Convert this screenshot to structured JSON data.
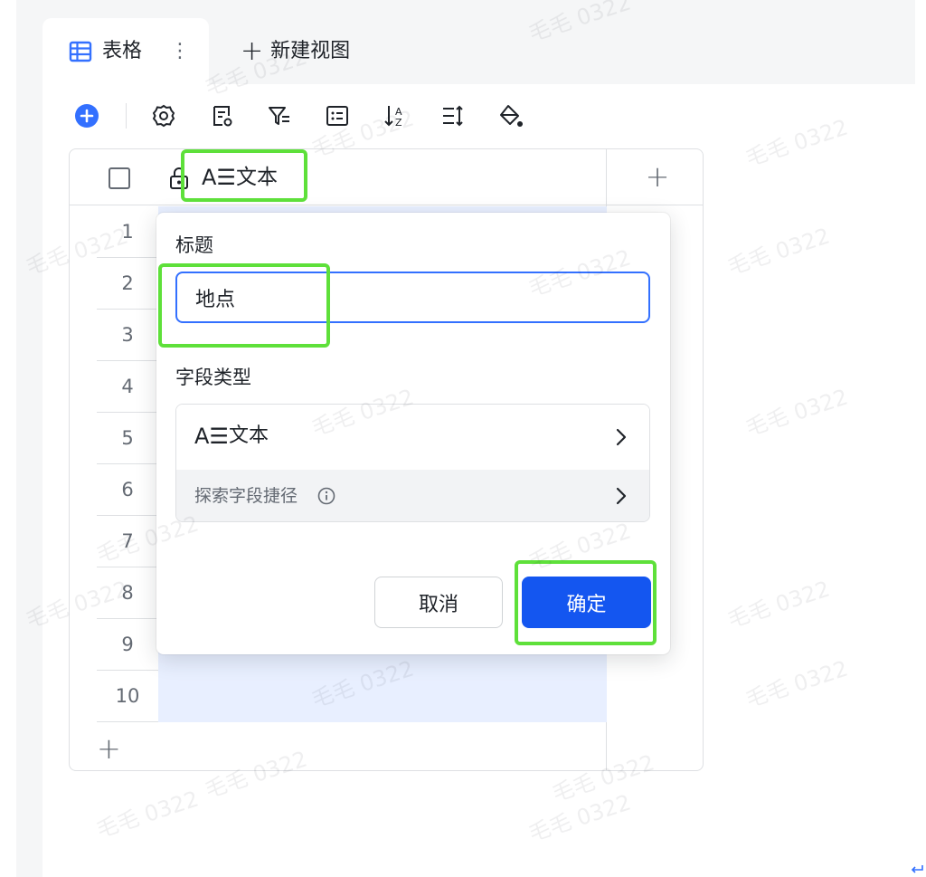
{
  "view_tabs": {
    "active_tab_label": "表格",
    "more_glyph": "⋮",
    "new_view_plus": "+",
    "new_view_label": "新建视图"
  },
  "toolbar": {
    "icons": [
      "add-record-icon",
      "settings-icon",
      "field-settings-icon",
      "filter-icon",
      "group-icon",
      "sort-icon",
      "row-height-icon",
      "fill-color-icon"
    ]
  },
  "grid": {
    "header_field_icon": "A☰",
    "header_field_label": "文本",
    "add_column_glyph": "+",
    "add_row_glyph": "+",
    "row_numbers": [
      "1",
      "2",
      "3",
      "4",
      "5",
      "6",
      "7",
      "8",
      "9",
      "10"
    ]
  },
  "field_popup": {
    "title_label": "标题",
    "title_input_value": "地点",
    "field_type_label": "字段类型",
    "field_type_icon": "A☰",
    "field_type_value": "文本",
    "explore_shortcuts_label": "探索字段捷径",
    "cancel_label": "取消",
    "confirm_label": "确定"
  },
  "watermark": {
    "text": "毛毛 0322"
  },
  "colors": {
    "accent": "#1456f0",
    "input_focus_border": "#3370ff",
    "highlight_outline": "#5ee03a",
    "selected_cell": "#e8efff"
  }
}
